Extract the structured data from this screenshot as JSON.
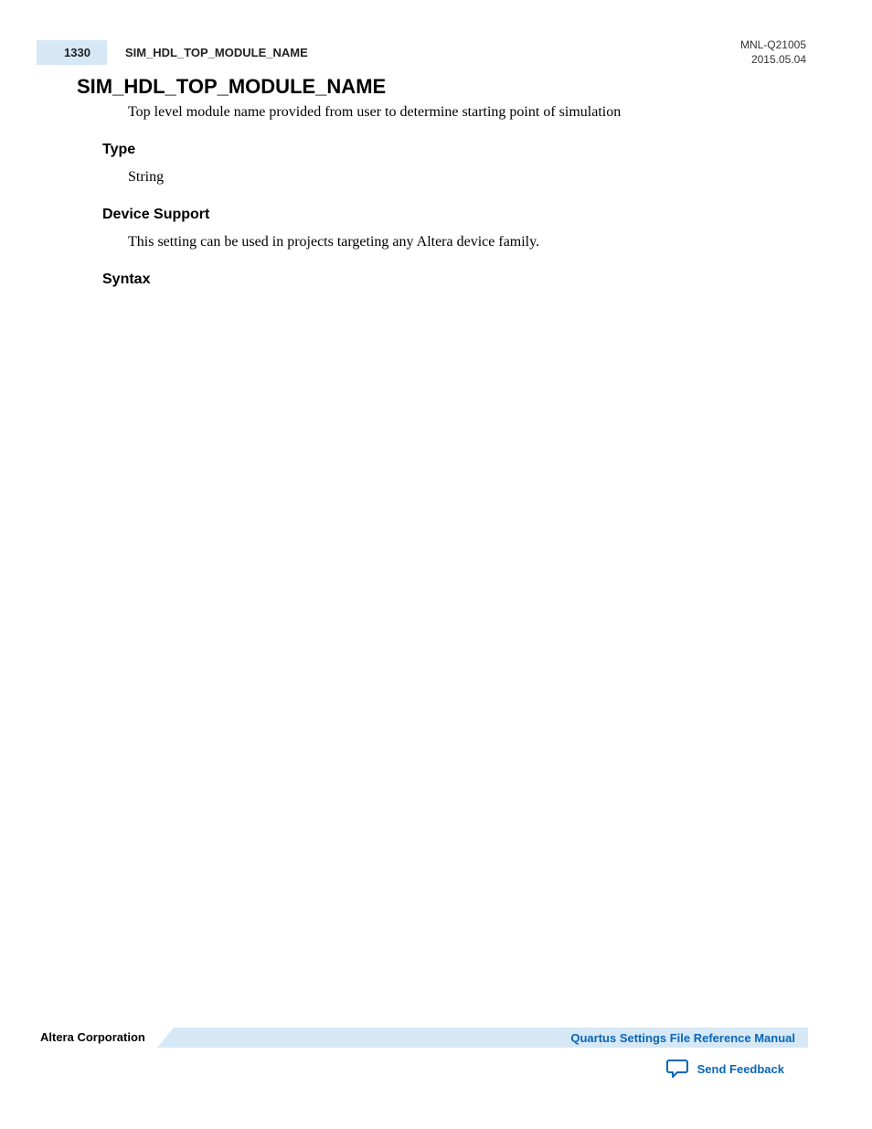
{
  "header": {
    "page_number": "1330",
    "running_title": "SIM_HDL_TOP_MODULE_NAME",
    "doc_id": "MNL-Q21005",
    "date": "2015.05.04"
  },
  "title": "SIM_HDL_TOP_MODULE_NAME",
  "description": "Top level module name provided from user to determine starting point of simulation",
  "sections": {
    "type": {
      "heading": "Type",
      "body": "String"
    },
    "device_support": {
      "heading": "Device Support",
      "body": "This setting can be used in projects targeting any Altera device family."
    },
    "syntax": {
      "heading": "Syntax"
    }
  },
  "footer": {
    "company": "Altera Corporation",
    "manual": "Quartus Settings File Reference Manual",
    "feedback": "Send Feedback"
  }
}
